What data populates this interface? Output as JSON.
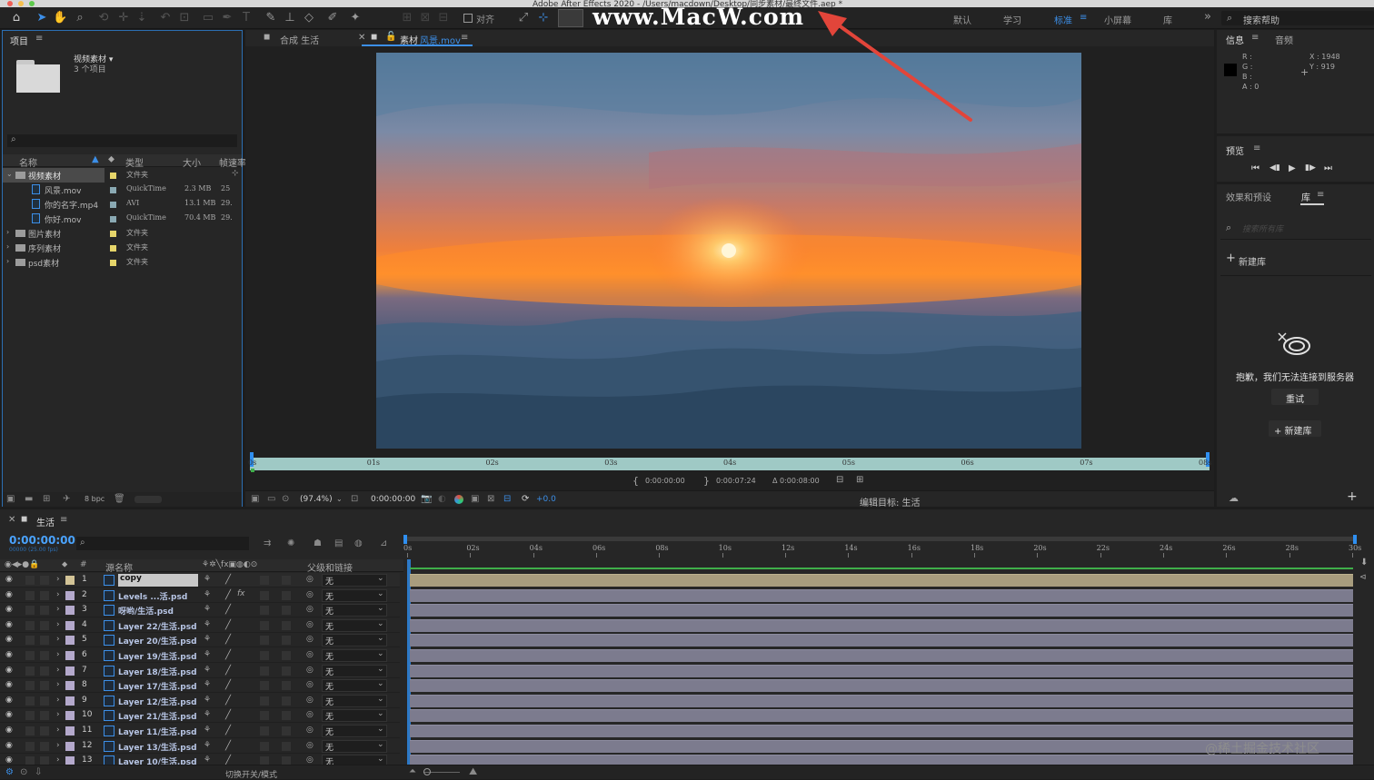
{
  "window": {
    "title": "Adobe After Effects 2020 - /Users/macdown/Desktop/同步素材/最终文件.aep *"
  },
  "watermark": "www.MacW.com",
  "credit": "@稀土掘金技术社区",
  "toolbar": {
    "snap_label": "对齐",
    "workspaces": [
      "默认",
      "学习",
      "标准",
      "小屏幕",
      "库"
    ],
    "more": "»",
    "help_search": "搜索帮助"
  },
  "project": {
    "tab": "项目",
    "selected_name": "视频素材 ▾",
    "selected_count": "3 个项目",
    "search_icon": "⌕",
    "columns": [
      "名称",
      "类型",
      "大小",
      "帧速率"
    ],
    "items": [
      {
        "name": "视频素材",
        "type": "文件夹",
        "size": "",
        "fps": "",
        "level": 0,
        "open": true
      },
      {
        "name": "风景.mov",
        "type": "QuickTime",
        "size": "2.3 MB",
        "fps": "25",
        "level": 1
      },
      {
        "name": "你的名字.mp4",
        "type": "AVI",
        "size": "13.1 MB",
        "fps": "29.",
        "level": 1
      },
      {
        "name": "你好.mov",
        "type": "QuickTime",
        "size": "70.4 MB",
        "fps": "29.",
        "level": 1
      },
      {
        "name": "图片素材",
        "type": "文件夹",
        "size": "",
        "fps": "",
        "level": 0
      },
      {
        "name": "序列素材",
        "type": "文件夹",
        "size": "",
        "fps": "",
        "level": 0
      },
      {
        "name": "psd素材",
        "type": "文件夹",
        "size": "",
        "fps": "",
        "level": 0
      }
    ],
    "bpc": "8 bpc"
  },
  "viewer": {
    "tab_comp": "合成 生活",
    "tab_footage_prefix": "素材",
    "tab_footage_name": "风景.mov",
    "ruler": [
      "0s",
      "01s",
      "02s",
      "03s",
      "04s",
      "05s",
      "06s",
      "07s",
      "08s"
    ],
    "in_point": "0:00:00:00",
    "out_point": "0:00:07:24",
    "duration": "Δ 0:00:08:00",
    "zoom": "(97.4%)",
    "timecode": "0:00:00:00",
    "exposure": "+0.0",
    "edit_target": "编辑目标: 生活",
    "sky_colors": [
      "#4a7192",
      "#7b8aa6",
      "#c47a6a",
      "#f0803a",
      "#ff9a30",
      "#3e5678",
      "#2a4566"
    ]
  },
  "info": {
    "tab_info": "信息",
    "tab_audio": "音频",
    "r": "R :",
    "g": "G :",
    "b": "B :",
    "a": "A : 0",
    "x": "X : 1948",
    "y": "Y : 919"
  },
  "preview": {
    "title": "预览",
    "controls": [
      "⏮",
      "◀▮",
      "▶",
      "▮▶",
      "⏭"
    ]
  },
  "library": {
    "tab_effects": "效果和预设",
    "tab_library": "库",
    "search_placeholder": "搜索所有库",
    "new_library": "新建库",
    "error_message": "抱歉，我们无法连接到服务器",
    "retry": "重试",
    "new_library_button": "+ 新建库"
  },
  "timeline": {
    "tab": "生活",
    "timecode": "0:00:00:00",
    "fps_info": "00000 (25.00 fps)",
    "columns": {
      "num": "#",
      "source": "源名称",
      "parent": "父级和链接"
    },
    "ruler": [
      "0s",
      "02s",
      "04s",
      "06s",
      "08s",
      "10s",
      "12s",
      "14s",
      "16s",
      "18s",
      "20s",
      "22s",
      "24s",
      "26s",
      "28s",
      "30s"
    ],
    "layers": [
      {
        "num": "1",
        "name": "copy",
        "parent": "无"
      },
      {
        "num": "2",
        "name": "Levels ...活.psd",
        "parent": "无"
      },
      {
        "num": "3",
        "name": "呀哟/生活.psd",
        "parent": "无"
      },
      {
        "num": "4",
        "name": "Layer 22/生活.psd",
        "parent": "无"
      },
      {
        "num": "5",
        "name": "Layer 20/生活.psd",
        "parent": "无"
      },
      {
        "num": "6",
        "name": "Layer 19/生活.psd",
        "parent": "无"
      },
      {
        "num": "7",
        "name": "Layer 18/生活.psd",
        "parent": "无"
      },
      {
        "num": "8",
        "name": "Layer 17/生活.psd",
        "parent": "无"
      },
      {
        "num": "9",
        "name": "Layer 12/生活.psd",
        "parent": "无"
      },
      {
        "num": "10",
        "name": "Layer 21/生活.psd",
        "parent": "无"
      },
      {
        "num": "11",
        "name": "Layer 11/生活.psd",
        "parent": "无"
      },
      {
        "num": "12",
        "name": "Layer 13/生活.psd",
        "parent": "无"
      },
      {
        "num": "13",
        "name": "Layer 10/生活.psd",
        "parent": "无"
      }
    ],
    "toggle_label": "切换开关/模式"
  },
  "colors": {
    "accent": "#2f8ff0",
    "timecode": "#4aa3ff",
    "footage_bar": "#7c7b8e",
    "track_green": "#3fae49",
    "work_area": "#9fc9c5",
    "arrow_red": "#e2453a"
  }
}
